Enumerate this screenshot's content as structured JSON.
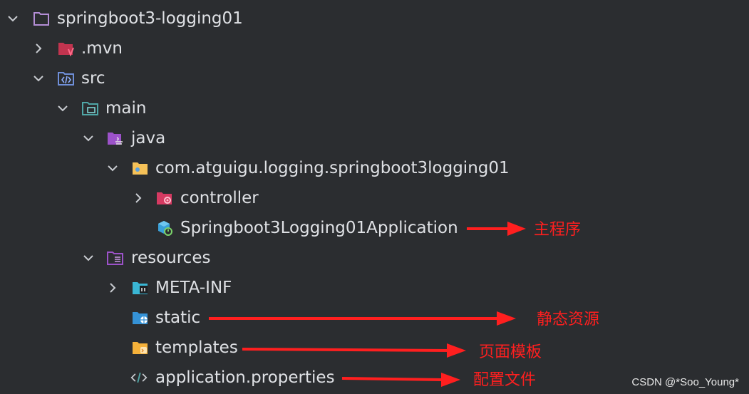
{
  "colors": {
    "background": "#2b2d30",
    "text": "#dfe1e5",
    "annotation": "#ff1f1f",
    "folder_module": "#b48ed6",
    "folder_mvn": "#c2344f",
    "folder_src": "#6f8fd9",
    "folder_main": "#4fa6a6",
    "folder_java": "#9c52c9",
    "folder_package": "#f5c158",
    "folder_controller": "#d63a62",
    "folder_resources": "#9c52c9",
    "folder_metainf": "#3ab6d4",
    "folder_static": "#3592d6",
    "folder_templates": "#f5b13a",
    "properties_icon": "#4fa6a6"
  },
  "tree": {
    "items": [
      {
        "label": "springboot3-logging01",
        "icon": "module-folder-icon",
        "expanded": true
      },
      {
        "label": ".mvn",
        "icon": "mvn-folder-icon",
        "expanded": false
      },
      {
        "label": "src",
        "icon": "src-folder-icon",
        "expanded": true
      },
      {
        "label": "main",
        "icon": "main-folder-icon",
        "expanded": true
      },
      {
        "label": "java",
        "icon": "java-folder-icon",
        "expanded": true
      },
      {
        "label": "com.atguigu.logging.springboot3logging01",
        "icon": "package-folder-icon",
        "expanded": true
      },
      {
        "label": "controller",
        "icon": "controller-folder-icon",
        "expanded": false
      },
      {
        "label": "Springboot3Logging01Application",
        "icon": "spring-boot-app-icon",
        "expanded": null
      },
      {
        "label": "resources",
        "icon": "resources-folder-icon",
        "expanded": true
      },
      {
        "label": "META-INF",
        "icon": "meta-inf-folder-icon",
        "expanded": false
      },
      {
        "label": "static",
        "icon": "static-folder-icon",
        "expanded": null
      },
      {
        "label": "templates",
        "icon": "templates-folder-icon",
        "expanded": null
      },
      {
        "label": "application.properties",
        "icon": "properties-file-icon",
        "expanded": null
      }
    ]
  },
  "annotations": {
    "main_program": "主程序",
    "static_resources": "静态资源",
    "page_templates": "页面模板",
    "config_file": "配置文件"
  },
  "watermark": "CSDN @*Soo_Young*"
}
